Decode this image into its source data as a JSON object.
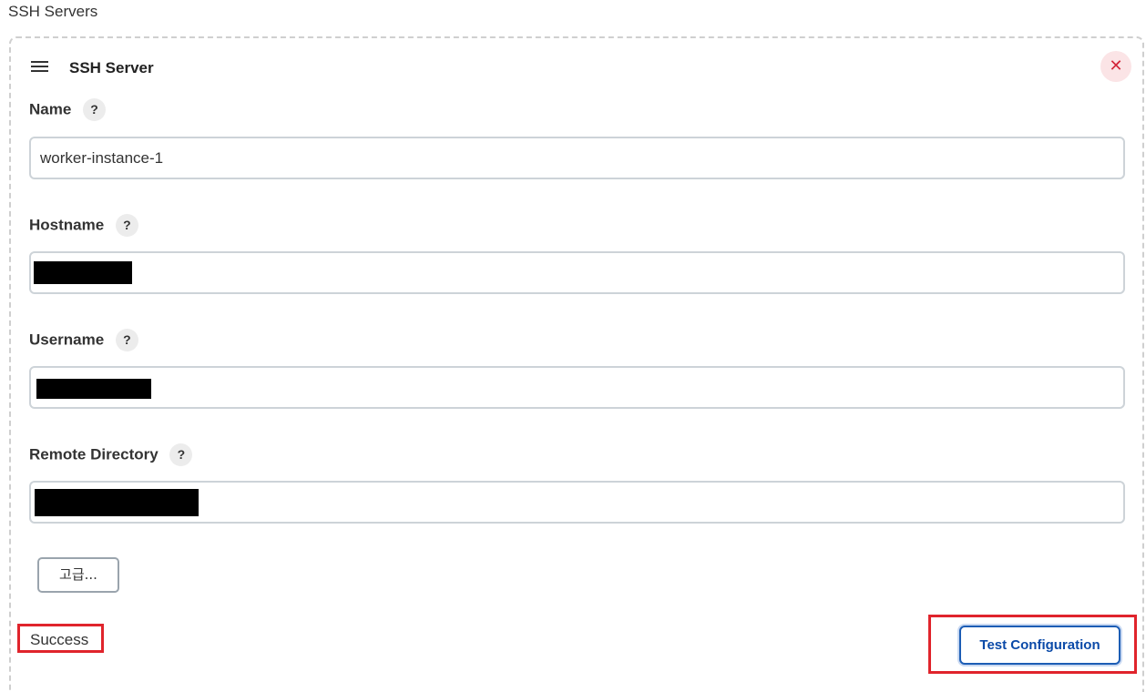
{
  "section": {
    "title": "SSH Servers"
  },
  "server": {
    "title": "SSH Server",
    "delete_symbol": "✕"
  },
  "fields": {
    "name": {
      "label": "Name",
      "value": "worker-instance-1"
    },
    "hostname": {
      "label": "Hostname",
      "value": ""
    },
    "username": {
      "label": "Username",
      "value": ""
    },
    "remote_directory": {
      "label": "Remote Directory",
      "value": ""
    }
  },
  "help_symbol": "?",
  "buttons": {
    "advanced": "고급...",
    "test_configuration": "Test Configuration"
  },
  "status": {
    "text": "Success"
  },
  "colors": {
    "accent": "#1c5db5",
    "highlight": "#e0242c",
    "delete": "#d3263a"
  },
  "icons": [
    "drag-handle-icon",
    "close-icon",
    "help-icon"
  ]
}
